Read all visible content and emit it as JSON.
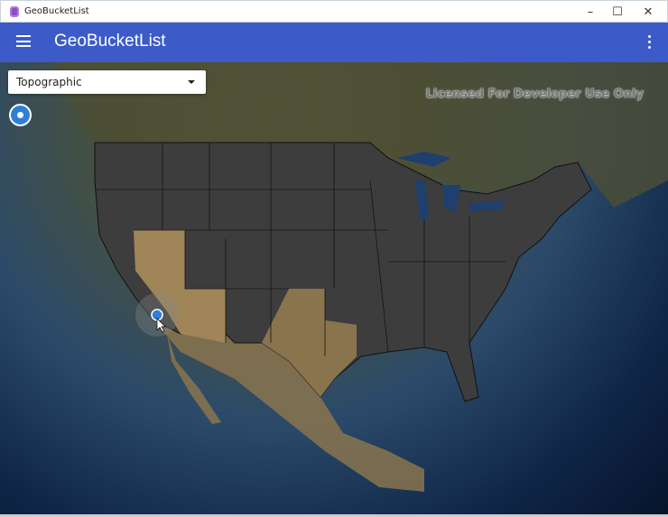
{
  "window": {
    "title": "GeoBucketList",
    "minimize": "–",
    "maximize": "☐",
    "close": "✕"
  },
  "appbar": {
    "title": "GeoBucketList",
    "menu_icon": "hamburger-icon",
    "more_icon": "more-vertical-icon"
  },
  "map": {
    "basemap_select": {
      "selected": "Topographic"
    },
    "watermark": "Licensed For Developer Use Only",
    "locate_icon": "locate-icon",
    "colors": {
      "appbar": "#3c5bc9",
      "states": "#3d3d3d",
      "location": "#2f7fd6"
    }
  }
}
